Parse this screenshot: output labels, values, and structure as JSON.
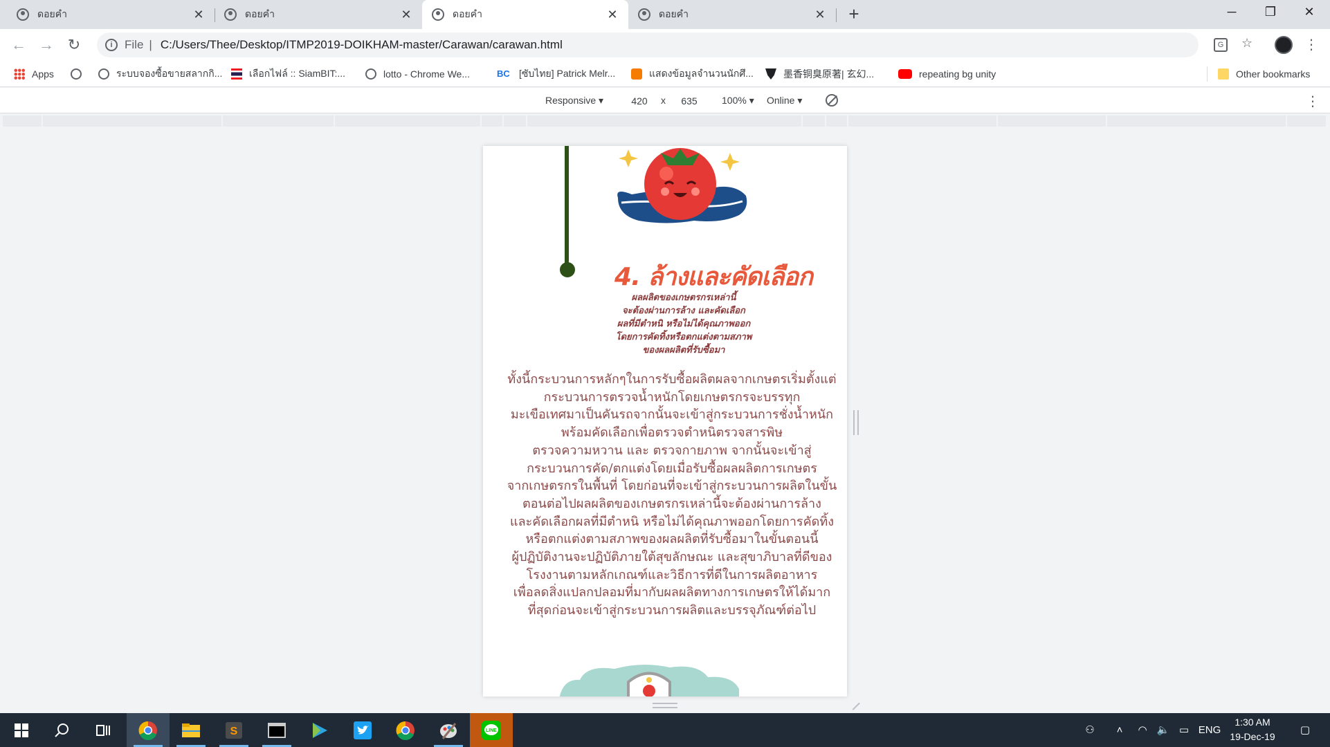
{
  "tabs": [
    {
      "title": "ดอยคำ",
      "active": false
    },
    {
      "title": "ดอยคำ",
      "active": false
    },
    {
      "title": "ดอยคำ",
      "active": true
    },
    {
      "title": "ดอยคำ",
      "active": false
    }
  ],
  "window": {
    "minimize": "─",
    "restore": "❐",
    "close": "✕"
  },
  "address_bar": {
    "scheme_label": "File",
    "url": "C:/Users/Thee/Desktop/ITMP2019-DOIKHAM-master/Carawan/carawan.html"
  },
  "bookmarks": {
    "apps_label": "Apps",
    "items": [
      {
        "label": "",
        "icon": "globe-icon"
      },
      {
        "label": "ระบบจองซื้อขายสลากกิ...",
        "icon": "globe-icon"
      },
      {
        "label": "เลือกไฟล์ :: SiamBIT:...",
        "icon": "thai-flag-icon"
      },
      {
        "label": "lotto - Chrome We...",
        "icon": "globe-icon"
      },
      {
        "label": "[ซับไทย] Patrick Melr...",
        "icon": "bc-icon"
      },
      {
        "label": "แสดงข้อมูลจำนวนนักศึ...",
        "icon": "orange-icon"
      },
      {
        "label": "墨香铜臭原著| 玄幻...",
        "icon": "shield-icon"
      },
      {
        "label": "repeating bg unity",
        "icon": "youtube-icon"
      }
    ],
    "other_label": "Other bookmarks"
  },
  "device_toolbar": {
    "device": "Responsive",
    "width": "420",
    "times": "x",
    "height": "635",
    "zoom": "100%",
    "network": "Online"
  },
  "page": {
    "heading": "4. ล้างและคัดเลือก",
    "subheading_lines": [
      "ผลผลิตของเกษตรกรเหล่านี้",
      "จะต้องผ่านการล้าง และคัดเลือก",
      "ผลที่มีตำหนิ หรือไม่ได้คุณภาพออก",
      "โดยการคัดทิ้งหรือตกแต่งตามสภาพ",
      "ของผลผลิตที่รับซื้อมา"
    ],
    "body_lines": [
      "ทั้งนี้กระบวนการหลักๆในการรับซื้อผลิตผลจากเกษตรเริ่มตั้งแต่",
      "กระบวนการตรวจน้ำหนักโดยเกษตรกรจะบรรทุก",
      "มะเขือเทศมาเป็นคันรถจากนั้นจะเข้าสู่กระบวนการชั่งน้ำหนัก",
      "พร้อมคัดเลือกเพื่อตรวจตำหนิตรวจสารพิษ",
      "ตรวจความหวาน และ ตรวจกายภาพ จากนั้นจะเข้าสู่",
      "กระบวนการคัด/ตกแต่งโดยเมื่อรับซื้อผลผลิตการเกษตร",
      "จากเกษตรกรในพื้นที่ โดยก่อนที่จะเข้าสู่กระบวนการผลิตในขั้น",
      "ตอนต่อไปผลผลิตของเกษตรกรเหล่านี้จะต้องผ่านการล้าง",
      "และคัดเลือกผลที่มีตำหนิ หรือไม่ได้คุณภาพออกโดยการคัดทิ้ง",
      "หรือตกแต่งตามสภาพของผลผลิตที่รับซื้อมาในขั้นตอนนี้",
      "ผู้ปฏิบัติงานจะปฏิบัติภายใต้สุขลักษณะ และสุขาภิบาลที่ดีของ",
      "โรงงานตามหลักเกณฑ์และวิธีการที่ดีในการผลิตอาหาร",
      "เพื่อลดสิ่งแปลกปลอมที่มากับผลผลิตทางการเกษตรให้ได้มาก",
      "ที่สุดก่อนจะเข้าสู่กระบวนการผลิตและบรรจุภัณฑ์ต่อไป"
    ],
    "colors": {
      "heading": "#e8593c",
      "body": "#8b4a4a",
      "stick": "#2d5016"
    }
  },
  "taskbar": {
    "apps": [
      "start",
      "search",
      "task-view",
      "chrome",
      "file-explorer",
      "sublime-text",
      "terminal",
      "media-player",
      "twitter",
      "chrome-2",
      "paint",
      "line"
    ],
    "tray": {
      "language": "ENG",
      "time": "1:30 AM",
      "date": "19-Dec-19"
    }
  }
}
